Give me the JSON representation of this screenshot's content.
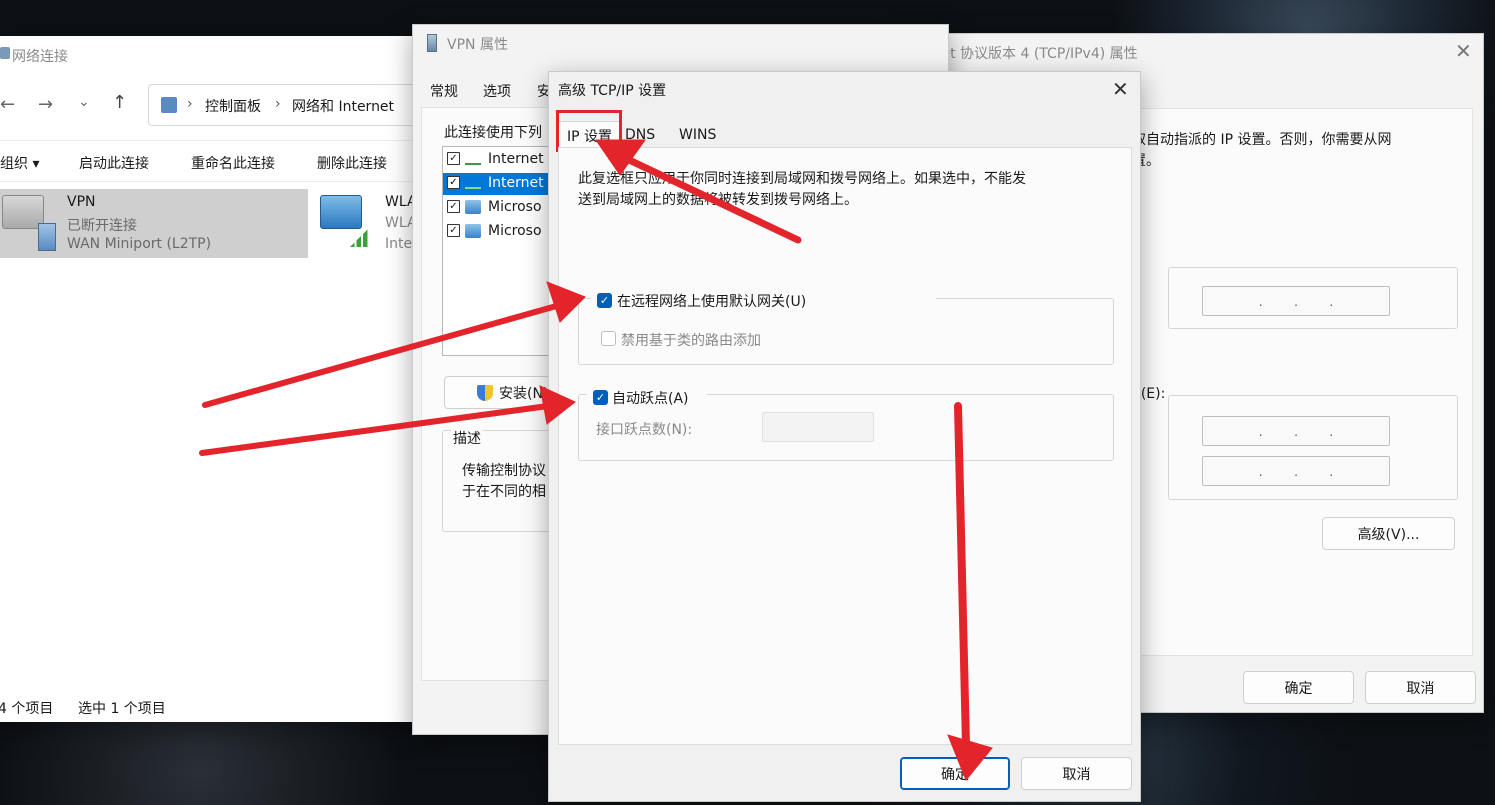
{
  "explorer": {
    "title": "网络连接",
    "breadcrumb": [
      "控制面板",
      "网络和 Internet"
    ],
    "toolbar": {
      "organize": "组织 ▾",
      "start": "启动此连接",
      "rename": "重命名此连接",
      "delete": "删除此连接"
    },
    "items": [
      {
        "name": "VPN",
        "status": "已断开连接",
        "device": "WAN Miniport (L2TP)"
      },
      {
        "name": "WLA",
        "status": "WLA",
        "device": "Inte"
      }
    ],
    "status_count": "4 个项目",
    "status_selected": "选中 1 个项目"
  },
  "vpn_props": {
    "title": "VPN 属性",
    "tabs": [
      "常规",
      "选项",
      "安"
    ],
    "list_label": "此连接使用下列",
    "list_items": [
      "Internet",
      "Internet",
      "Microso",
      "Microso"
    ],
    "install_label": "安装(N)",
    "description_title": "描述",
    "description_text_1": "传输控制协议",
    "description_text_2": "于在不同的相"
  },
  "ipv4_props": {
    "title": "Internet 协议版本 4 (TCP/IPv4) 属性",
    "text_1": "取自动指派的 IP 设置。否则，你需要从网",
    "text_2": "置。",
    "paren": ")",
    "dns_label": "E(E):",
    "ip_dots": ". . .",
    "advanced_label": "高级(V)...",
    "ok_label": "确定",
    "cancel_label": "取消"
  },
  "advanced": {
    "title": "高级 TCP/IP 设置",
    "tabs": [
      "IP 设置",
      "DNS",
      "WINS"
    ],
    "desc_1": "此复选框只应用于你同时连接到局域网和拨号网络上。如果选中，不能发",
    "desc_2": "送到局域网上的数据将被转发到拨号网络上。",
    "use_gateway_label": "在远程网络上使用默认网关(U)",
    "disable_class_label": "禁用基于类的路由添加",
    "auto_metric_label": "自动跃点(A)",
    "interface_metric_label": "接口跃点数(N):",
    "ok_label": "确定",
    "cancel_label": "取消"
  },
  "colors": {
    "accent": "#005fb8",
    "arrow": "#e3242b",
    "highlight_box": "#e3242b"
  }
}
